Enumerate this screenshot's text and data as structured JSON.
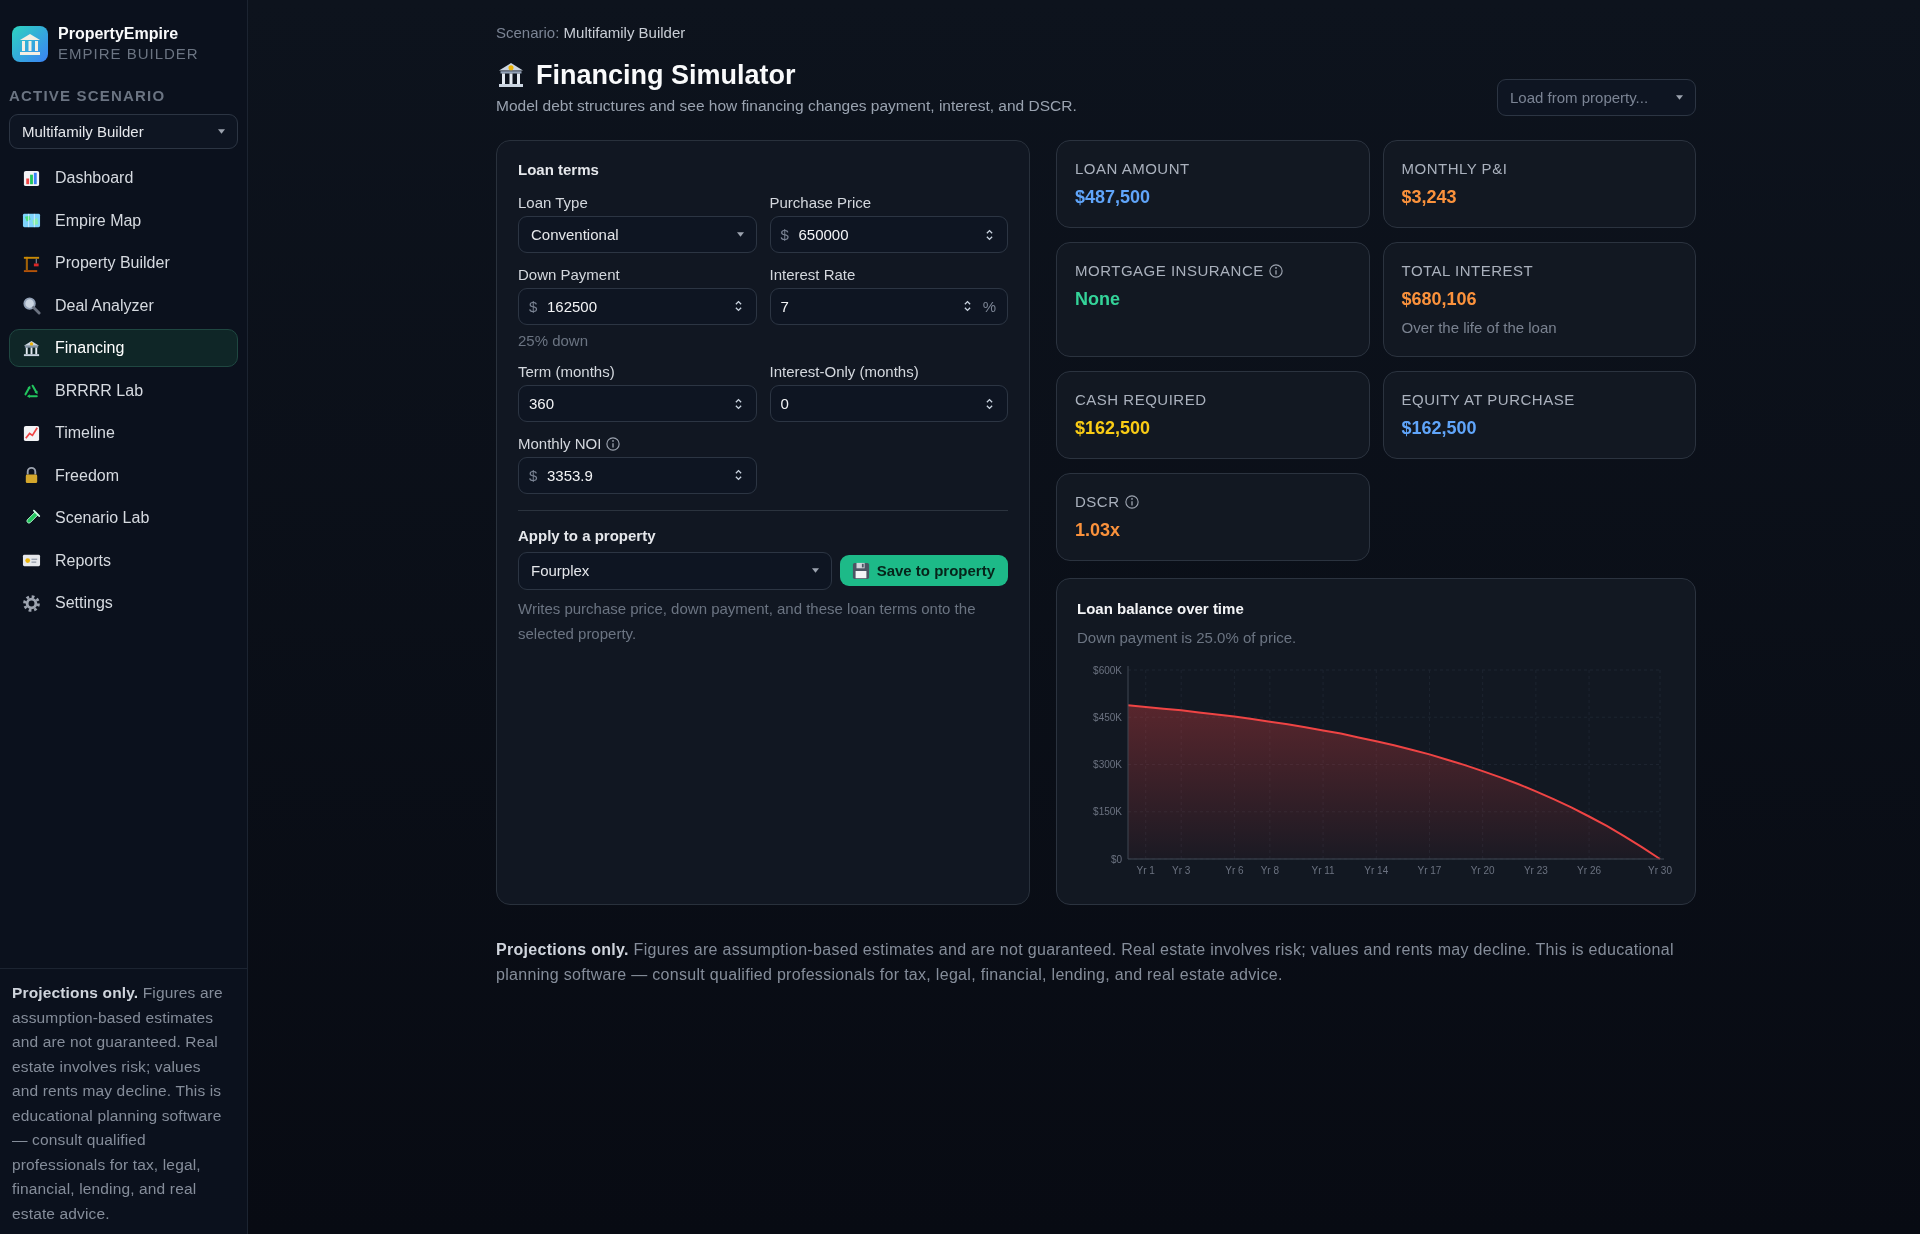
{
  "sidebar": {
    "brand": {
      "name": "PropertyEmpire",
      "tagline": "EMPIRE BUILDER"
    },
    "scenario": {
      "label": "ACTIVE SCENARIO",
      "value": "Multifamily Builder"
    },
    "nav": [
      {
        "label": "Dashboard",
        "selected": false
      },
      {
        "label": "Empire Map",
        "selected": false
      },
      {
        "label": "Property Builder",
        "selected": false
      },
      {
        "label": "Deal Analyzer",
        "selected": false
      },
      {
        "label": "Financing",
        "selected": true
      },
      {
        "label": "BRRRR Lab",
        "selected": false
      },
      {
        "label": "Timeline",
        "selected": false
      },
      {
        "label": "Freedom",
        "selected": false
      },
      {
        "label": "Scenario Lab",
        "selected": false
      },
      {
        "label": "Reports",
        "selected": false
      },
      {
        "label": "Settings",
        "selected": false
      }
    ],
    "disclaimer": "**Projections only.** Figures are assumption-based estimates and are not guaranteed. Real estate involves risk; values and rents may decline. This is educational planning software — consult qualified professionals for tax, legal, financial, lending, and real estate advice."
  },
  "header": {
    "scenario_label": "Scenario:",
    "scenario_name": "Multifamily Builder",
    "title": "Financing Simulator",
    "subtitle": "Model debt structures and see how financing changes payment, interest, and DSCR.",
    "load_select": {
      "placeholder": "Load from property..."
    }
  },
  "loan_terms": {
    "title": "Loan terms",
    "fields": [
      {
        "kind": "select",
        "label": "Loan Type",
        "value": "Conventional",
        "info": false
      },
      {
        "kind": "number",
        "label": "Purchase Price",
        "prefix": "$",
        "value": "650000",
        "info": false
      },
      {
        "kind": "number",
        "label": "Down Payment",
        "prefix": "$",
        "value": "162500",
        "hint": "25% down",
        "info": false
      },
      {
        "kind": "number",
        "label": "Interest Rate",
        "value": "7",
        "suffix": "%",
        "info": false
      },
      {
        "kind": "number",
        "label": "Term (months)",
        "value": "360",
        "info": false
      },
      {
        "kind": "number",
        "label": "Interest-Only (months)",
        "value": "0",
        "info": false
      },
      {
        "kind": "number",
        "label": "Monthly NOI",
        "prefix": "$",
        "value": "3353.9",
        "info": true
      }
    ],
    "apply": {
      "title": "Apply to a property",
      "property_select": {
        "value": "Fourplex"
      },
      "save_button": "Save to property",
      "note": "Writes purchase price, down payment, and these loan terms onto the selected property."
    }
  },
  "stats": [
    {
      "label": "LOAN AMOUNT",
      "value": "$487,500",
      "color": "#60a5fa",
      "info": false
    },
    {
      "label": "MONTHLY P&I",
      "value": "$3,243",
      "color": "#fb923c",
      "info": false
    },
    {
      "label": "MORTGAGE INSURANCE",
      "value": "None",
      "color": "#34d399",
      "info": true
    },
    {
      "label": "TOTAL INTEREST",
      "value": "$680,106",
      "color": "#fb923c",
      "info": false,
      "note": "Over the life of the loan"
    },
    {
      "label": "CASH REQUIRED",
      "value": "$162,500",
      "color": "#facc15",
      "info": false
    },
    {
      "label": "EQUITY AT PURCHASE",
      "value": "$162,500",
      "color": "#60a5fa",
      "info": false
    },
    {
      "label": "DSCR",
      "value": "1.03x",
      "color": "#fb923c",
      "info": true
    }
  ],
  "chart_card": {
    "subtitle": "Down payment is 25.0% of price.",
    "chart_data": {
      "type": "area",
      "title": "Loan balance over time",
      "categories": [
        null,
        "Yr 1",
        null,
        "Yr 3",
        null,
        null,
        "Yr 6",
        null,
        "Yr 8",
        null,
        null,
        "Yr 11",
        null,
        null,
        "Yr 14",
        null,
        null,
        "Yr 17",
        null,
        null,
        "Yr 20",
        null,
        null,
        "Yr 23",
        null,
        null,
        "Yr 26",
        null,
        null,
        null,
        "Yr 30"
      ],
      "series": [
        {
          "color": "#ef4444",
          "values": [
            488000,
            483000,
            477000,
            472000,
            465000,
            459000,
            452000,
            444000,
            436000,
            428000,
            418000,
            408000,
            398000,
            386000,
            374000,
            361000,
            347000,
            332000,
            315000,
            298000,
            279000,
            259000,
            238000,
            215000,
            190000,
            164000,
            135000,
            105000,
            72000,
            37000,
            0
          ]
        }
      ],
      "ylim": [
        0,
        600000
      ],
      "yticks": [
        {
          "value": 0,
          "label": "$0"
        },
        {
          "value": 150000,
          "label": "$150K"
        },
        {
          "value": 300000,
          "label": "$300K"
        },
        {
          "value": 450000,
          "label": "$450K"
        },
        {
          "value": 600000,
          "label": "$600K"
        }
      ],
      "grid": true
    }
  },
  "disclaimer": "**Projections only.** Figures are assumption-based estimates and are not guaranteed. Real estate involves risk; values and rents may decline. This is educational planning software — consult qualified professionals for tax, legal, financial, lending, and real estate advice."
}
